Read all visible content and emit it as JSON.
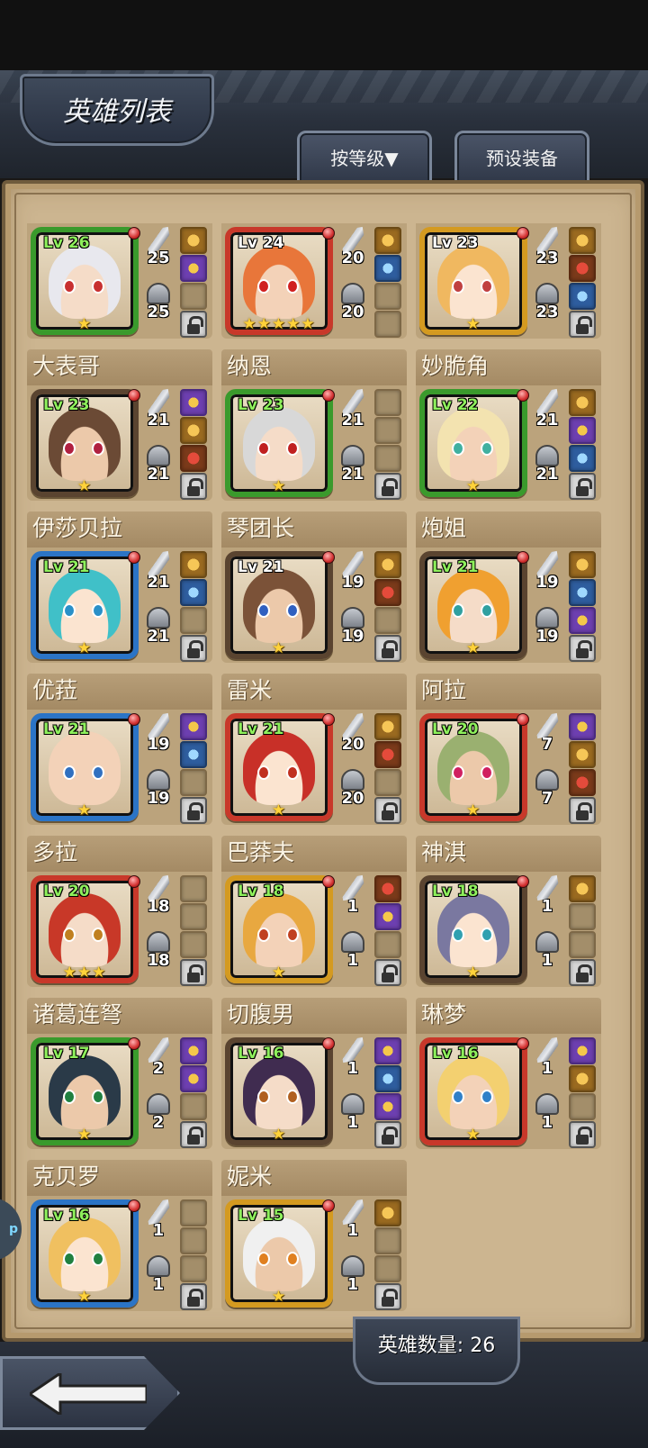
{
  "header": {
    "title": "英雄列表"
  },
  "tabs": {
    "sort_label": "按等级▼",
    "preset_label": "预设装备"
  },
  "footer": {
    "hero_count_label": "英雄数量: 26"
  },
  "side_bubble": "p",
  "colors": {
    "green": "#3a9a2c",
    "red": "#c8382a",
    "blue": "#2b74c6",
    "gold": "#d49a20",
    "brown": "#5a4430",
    "purple": "#6b3fa6"
  },
  "heroes": [
    {
      "name": "",
      "level": "Lv 26",
      "atk": "25",
      "def": "25",
      "stars": "★",
      "border": "green",
      "slots": [
        "item-gold",
        "item",
        "empty",
        "lock"
      ],
      "white_level": false
    },
    {
      "name": "",
      "level": "Lv 24",
      "atk": "20",
      "def": "20",
      "stars": "★★★★★",
      "border": "red",
      "slots": [
        "item-gold",
        "item-blue",
        "empty",
        "empty"
      ],
      "white_level": true
    },
    {
      "name": "",
      "level": "Lv 23",
      "atk": "23",
      "def": "23",
      "stars": "★",
      "border": "gold",
      "slots": [
        "item-gold",
        "item-red",
        "item-blue",
        "lock"
      ],
      "white_level": true
    },
    {
      "name": "大表哥",
      "level": "Lv 23",
      "atk": "21",
      "def": "21",
      "stars": "★",
      "border": "brown",
      "slots": [
        "item",
        "item-gold",
        "item-red",
        "lock"
      ],
      "white_level": false
    },
    {
      "name": "纳恩",
      "level": "Lv 23",
      "atk": "21",
      "def": "21",
      "stars": "★",
      "border": "green",
      "slots": [
        "empty",
        "empty",
        "empty",
        "lock"
      ],
      "white_level": false
    },
    {
      "name": "妙脆角",
      "level": "Lv 22",
      "atk": "21",
      "def": "21",
      "stars": "★",
      "border": "green",
      "slots": [
        "item-gold",
        "item",
        "item-blue",
        "lock"
      ],
      "white_level": false
    },
    {
      "name": "伊莎贝拉",
      "level": "Lv 21",
      "atk": "21",
      "def": "21",
      "stars": "★",
      "border": "blue",
      "slots": [
        "item-gold",
        "item-blue",
        "empty",
        "lock"
      ],
      "white_level": false
    },
    {
      "name": "琴团长",
      "level": "Lv 21",
      "atk": "19",
      "def": "19",
      "stars": "★",
      "border": "brown",
      "slots": [
        "item-gold",
        "item-red",
        "empty",
        "lock"
      ],
      "white_level": true
    },
    {
      "name": "炮姐",
      "level": "Lv 21",
      "atk": "19",
      "def": "19",
      "stars": "★",
      "border": "brown",
      "slots": [
        "item-gold",
        "item-blue",
        "item",
        "lock"
      ],
      "white_level": false
    },
    {
      "name": "优菈",
      "level": "Lv 21",
      "atk": "19",
      "def": "19",
      "stars": "★",
      "border": "blue",
      "slots": [
        "item",
        "item-blue",
        "empty",
        "lock"
      ],
      "white_level": false
    },
    {
      "name": "雷米",
      "level": "Lv 21",
      "atk": "20",
      "def": "20",
      "stars": "★",
      "border": "red",
      "slots": [
        "item-gold",
        "item-red",
        "empty",
        "lock"
      ],
      "white_level": false
    },
    {
      "name": "阿拉",
      "level": "Lv 20",
      "atk": "7",
      "def": "7",
      "stars": "★",
      "border": "red",
      "slots": [
        "item",
        "item-gold",
        "item-red",
        "lock"
      ],
      "white_level": false
    },
    {
      "name": "多拉",
      "level": "Lv 20",
      "atk": "18",
      "def": "18",
      "stars": "★★★",
      "border": "red",
      "slots": [
        "empty",
        "empty",
        "empty",
        "lock"
      ],
      "white_level": false
    },
    {
      "name": "巴莽夫",
      "level": "Lv 18",
      "atk": "1",
      "def": "1",
      "stars": "★",
      "border": "gold",
      "slots": [
        "item-red",
        "item",
        "empty",
        "lock"
      ],
      "white_level": false
    },
    {
      "name": "神淇",
      "level": "Lv 18",
      "atk": "1",
      "def": "1",
      "stars": "★",
      "border": "brown",
      "slots": [
        "item-gold",
        "empty",
        "empty",
        "lock"
      ],
      "white_level": false
    },
    {
      "name": "诸葛连弩",
      "level": "Lv 17",
      "atk": "2",
      "def": "2",
      "stars": "★",
      "border": "green",
      "slots": [
        "item",
        "item",
        "empty",
        "lock"
      ],
      "white_level": false
    },
    {
      "name": "切腹男",
      "level": "Lv 16",
      "atk": "1",
      "def": "1",
      "stars": "★",
      "border": "brown",
      "slots": [
        "item",
        "item-blue",
        "item",
        "lock"
      ],
      "white_level": false
    },
    {
      "name": "琳梦",
      "level": "Lv 16",
      "atk": "1",
      "def": "1",
      "stars": "★",
      "border": "red",
      "slots": [
        "item",
        "item-gold",
        "empty",
        "lock"
      ],
      "white_level": false
    },
    {
      "name": "克贝罗",
      "level": "Lv 16",
      "atk": "1",
      "def": "1",
      "stars": "★",
      "border": "blue",
      "slots": [
        "empty",
        "empty",
        "empty",
        "lock"
      ],
      "white_level": false
    },
    {
      "name": "妮米",
      "level": "Lv 15",
      "atk": "1",
      "def": "1",
      "stars": "★",
      "border": "gold",
      "slots": [
        "item-gold",
        "empty",
        "empty",
        "lock"
      ],
      "white_level": false
    }
  ]
}
